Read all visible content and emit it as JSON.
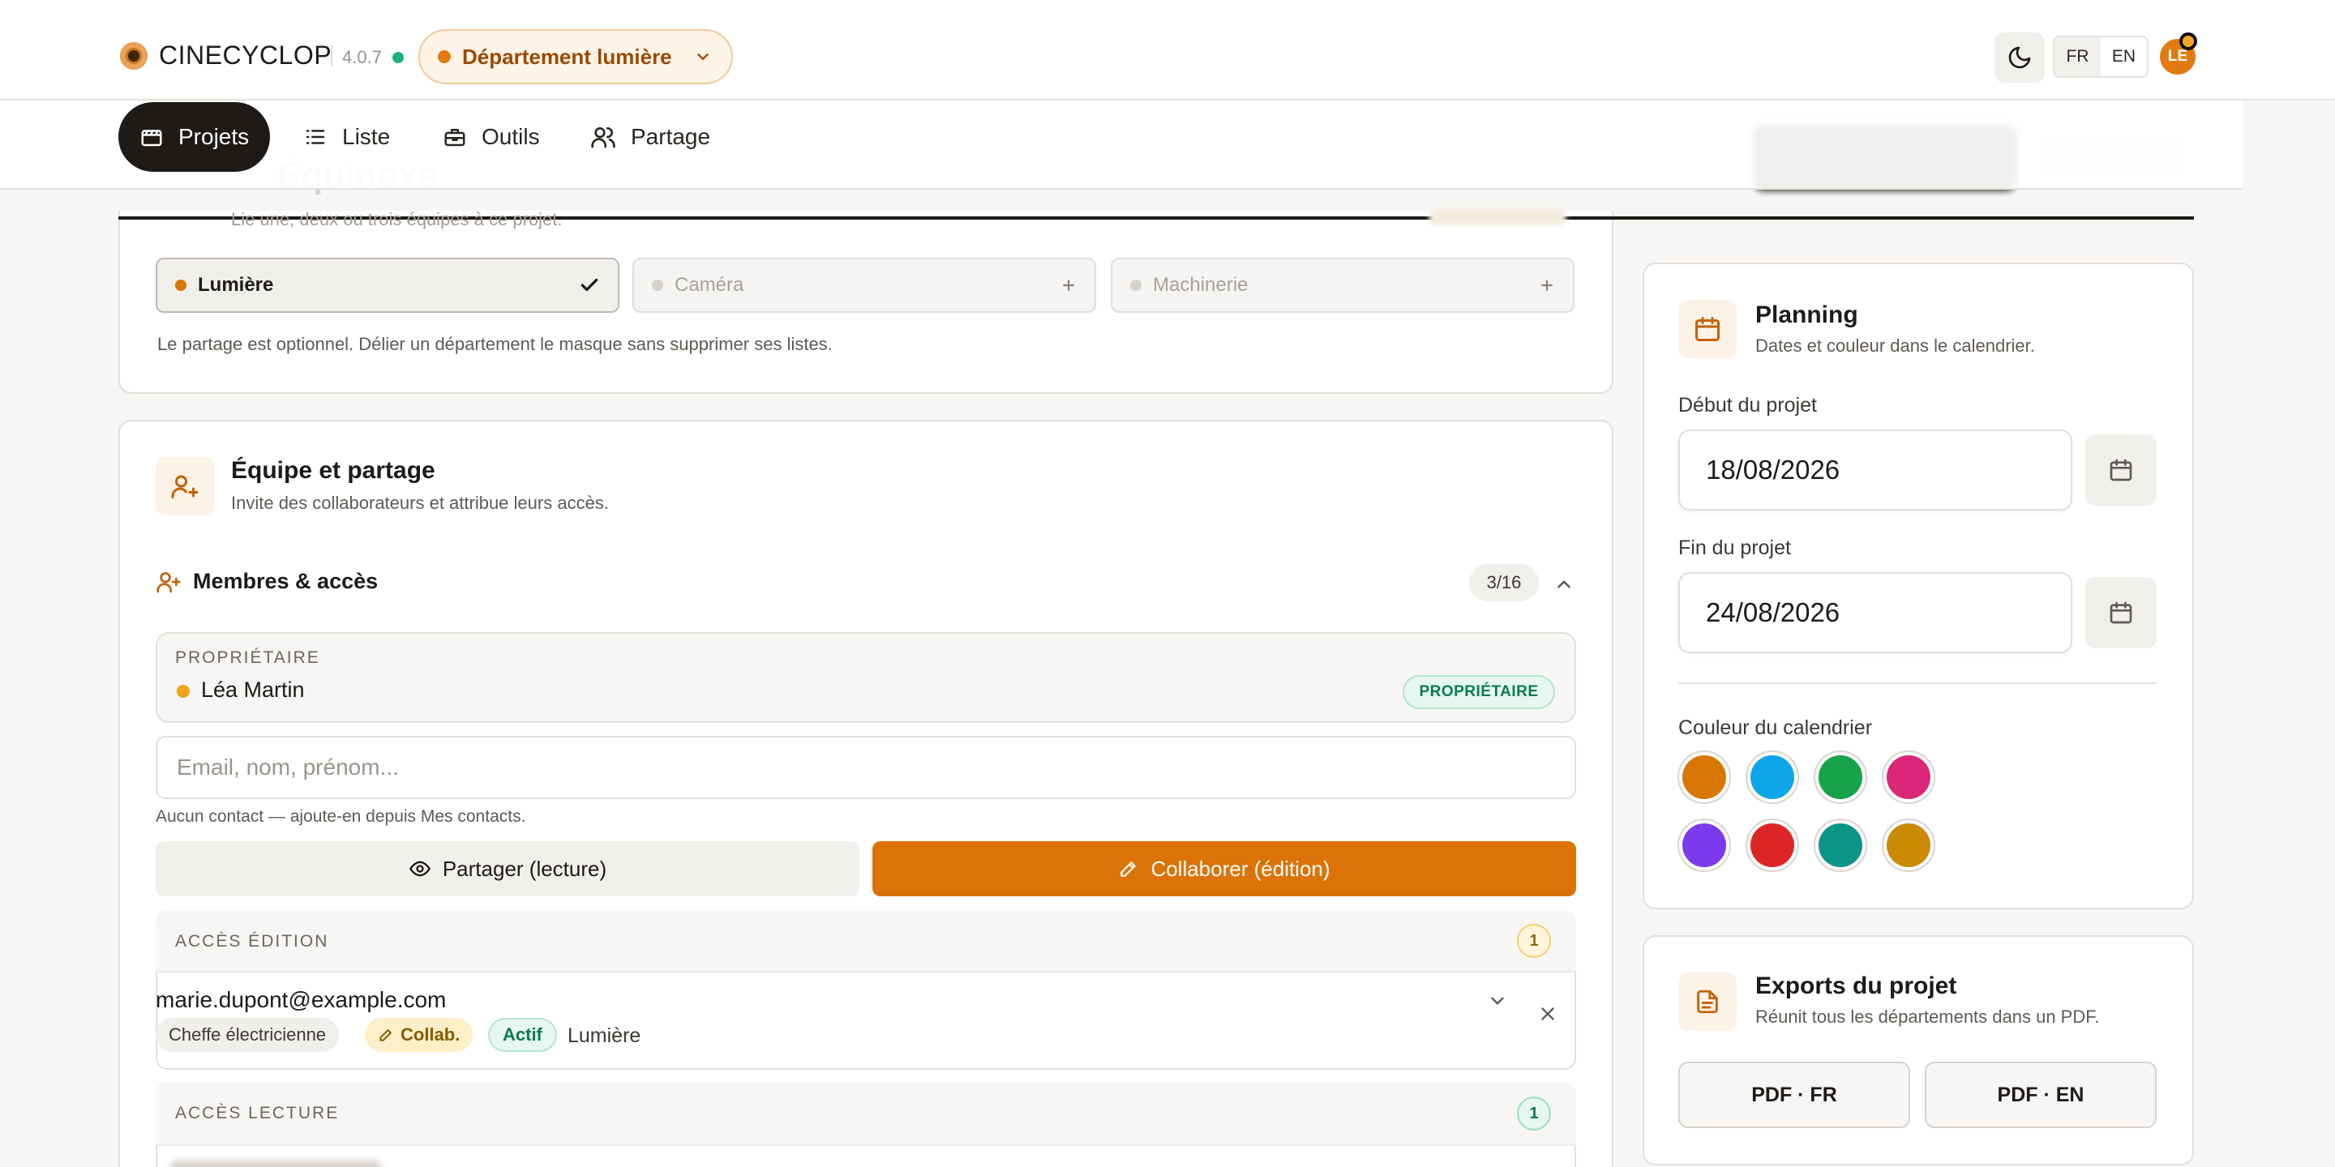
{
  "header": {
    "brand": "CINECYCLOP",
    "version": "4.0.7",
    "department": "Département lumière",
    "lang_fr": "FR",
    "lang_en": "EN",
    "avatar_initials": "LE",
    "accent": "#dc7308"
  },
  "nav": {
    "items": [
      {
        "label": "Projets",
        "icon": "clapperboard-icon",
        "active": true
      },
      {
        "label": "Liste",
        "icon": "list-icon"
      },
      {
        "label": "Outils",
        "icon": "toolbox-icon"
      },
      {
        "label": "Partage",
        "icon": "users-icon"
      }
    ]
  },
  "departments": {
    "ghost_title": "Équinoxe",
    "ghost_subtitle": "Lie une, deux ou trois équipes à ce projet.",
    "options": [
      {
        "label": "Lumière",
        "selected": true,
        "color": "#d97706"
      },
      {
        "label": "Caméra",
        "selected": false,
        "color": "#d4d0cb"
      },
      {
        "label": "Machinerie",
        "selected": false,
        "color": "#d4d0cb"
      }
    ],
    "note": "Le partage est optionnel. Délier un département le masque sans supprimer ses listes."
  },
  "team": {
    "title": "Équipe et partage",
    "subtitle": "Invite des collaborateurs et attribue leurs accès.",
    "members_title": "Membres & accès",
    "members_count": "3/16",
    "owner_caption": "PROPRIÉTAIRE",
    "owner_name": "Léa Martin",
    "owner_badge": "PROPRIÉTAIRE",
    "search_placeholder": "Email, nom, prénom...",
    "no_contacts": "Aucun contact — ajoute-en depuis Mes contacts.",
    "share_read_label": "Partager (lecture)",
    "share_edit_label": "Collaborer (édition)",
    "edit_access": {
      "caption": "ACCÈS ÉDITION",
      "count": "1",
      "member": {
        "email": "marie.dupont@example.com",
        "role": "Cheffe électricienne",
        "mode": "Collab.",
        "status": "Actif",
        "department": "Lumière"
      }
    },
    "read_access": {
      "caption": "ACCÈS LECTURE",
      "count": "1"
    }
  },
  "planning": {
    "title": "Planning",
    "subtitle": "Dates et couleur dans le calendrier.",
    "start_label": "Début du projet",
    "start_value": "18/08/2026",
    "end_label": "Fin du projet",
    "end_value": "24/08/2026",
    "color_label": "Couleur du calendrier",
    "colors": [
      "#d97706",
      "#0ea5e9",
      "#16a34a",
      "#db2777",
      "#7c3aed",
      "#dc2626",
      "#0d9488",
      "#ca8a04"
    ],
    "selected_color": "#d97706"
  },
  "exports": {
    "title": "Exports du projet",
    "subtitle": "Réunit tous les départements dans un PDF.",
    "pdf_fr": "PDF · FR",
    "pdf_en": "PDF · EN"
  }
}
